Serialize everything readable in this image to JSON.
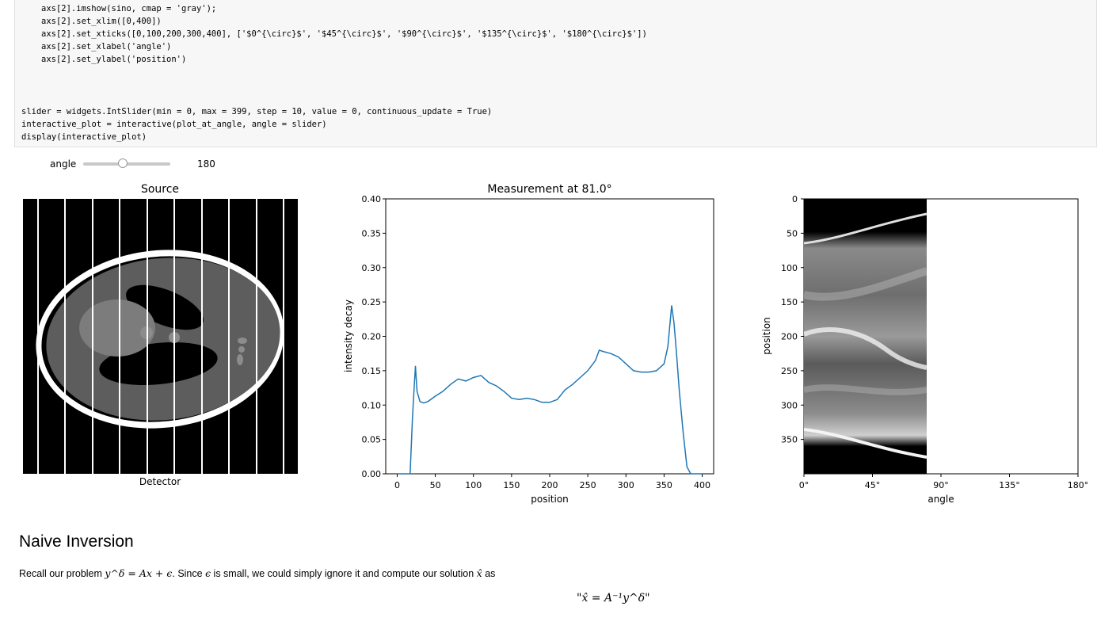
{
  "code_cell": {
    "lines_indented": [
      "axs[2].imshow(sino, cmap = 'gray');",
      "axs[2].set_xlim([0,400])",
      "axs[2].set_xticks([0,100,200,300,400], ['$0^{\\circ}$', '$45^{\\circ}$', '$90^{\\circ}$', '$135^{\\circ}$', '$180^{\\circ}$'])",
      "axs[2].set_xlabel('angle')",
      "axs[2].set_ylabel('position')"
    ],
    "lines_toplevel": [
      "slider = widgets.IntSlider(min = 0, max = 399, step = 10, value = 0, continuous_update = True)",
      "interactive_plot = interactive(plot_at_angle, angle = slider)",
      "display(interactive_plot)"
    ]
  },
  "slider": {
    "label": "angle",
    "value": "180",
    "min": 0,
    "max": 399,
    "fraction": 0.45
  },
  "source_panel": {
    "title": "Source",
    "xlabel": "Detector"
  },
  "measurement_panel": {
    "title": "Measurement at 81.0°",
    "xlabel": "position",
    "ylabel": "intensity decay",
    "yticks": [
      "0.00",
      "0.05",
      "0.10",
      "0.15",
      "0.20",
      "0.25",
      "0.30",
      "0.35",
      "0.40"
    ],
    "xticks": [
      "0",
      "50",
      "100",
      "150",
      "200",
      "250",
      "300",
      "350",
      "400"
    ]
  },
  "sinogram_panel": {
    "xlabel": "angle",
    "ylabel": "position",
    "yticks": [
      "0",
      "50",
      "100",
      "150",
      "200",
      "250",
      "300",
      "350"
    ],
    "xticks": [
      "0°",
      "45°",
      "90°",
      "135°",
      "180°"
    ]
  },
  "chart_data": [
    {
      "type": "image",
      "title": "Source",
      "xlabel": "Detector",
      "ylabel": ""
    },
    {
      "type": "line",
      "title": "Measurement at 81.0°",
      "xlabel": "position",
      "ylabel": "intensity decay",
      "xlim": [
        -15,
        415
      ],
      "ylim": [
        0,
        0.4
      ],
      "x": [
        0,
        17,
        20,
        22,
        24,
        26,
        30,
        35,
        40,
        50,
        60,
        70,
        80,
        90,
        100,
        110,
        120,
        130,
        140,
        150,
        160,
        170,
        180,
        190,
        200,
        210,
        220,
        230,
        240,
        250,
        260,
        265,
        270,
        280,
        290,
        300,
        310,
        320,
        330,
        340,
        350,
        355,
        360,
        363,
        366,
        370,
        375,
        380,
        385,
        390,
        400
      ],
      "series": [
        {
          "values": [
            0,
            0,
            0.08,
            0.12,
            0.157,
            0.12,
            0.105,
            0.103,
            0.105,
            0.113,
            0.12,
            0.13,
            0.138,
            0.135,
            0.14,
            0.143,
            0.133,
            0.128,
            0.12,
            0.11,
            0.108,
            0.11,
            0.108,
            0.104,
            0.104,
            0.108,
            0.122,
            0.13,
            0.14,
            0.15,
            0.165,
            0.18,
            0.178,
            0.175,
            0.17,
            0.16,
            0.15,
            0.148,
            0.148,
            0.15,
            0.16,
            0.185,
            0.245,
            0.22,
            0.18,
            0.12,
            0.06,
            0.01,
            0,
            0,
            0
          ]
        }
      ]
    },
    {
      "type": "heatmap",
      "xlabel": "angle",
      "ylabel": "position",
      "xlim": [
        0,
        400
      ],
      "ylim": [
        400,
        0
      ],
      "filled_columns_until": 180
    }
  ],
  "markdown": {
    "heading": "Naive Inversion",
    "para_part1": "Recall our problem ",
    "math1": "y^δ = Ax + ϵ",
    "para_part2": ". Since ",
    "math2": "ϵ",
    "para_part3": " is small, we could simply ignore it and compute our solution ",
    "math3": "x̂",
    "para_part4": " as",
    "display_math": "\"x̂ = A⁻¹y^δ\""
  },
  "colors": {
    "line": "#1f77b4",
    "code_bg": "#f7f7f7"
  }
}
